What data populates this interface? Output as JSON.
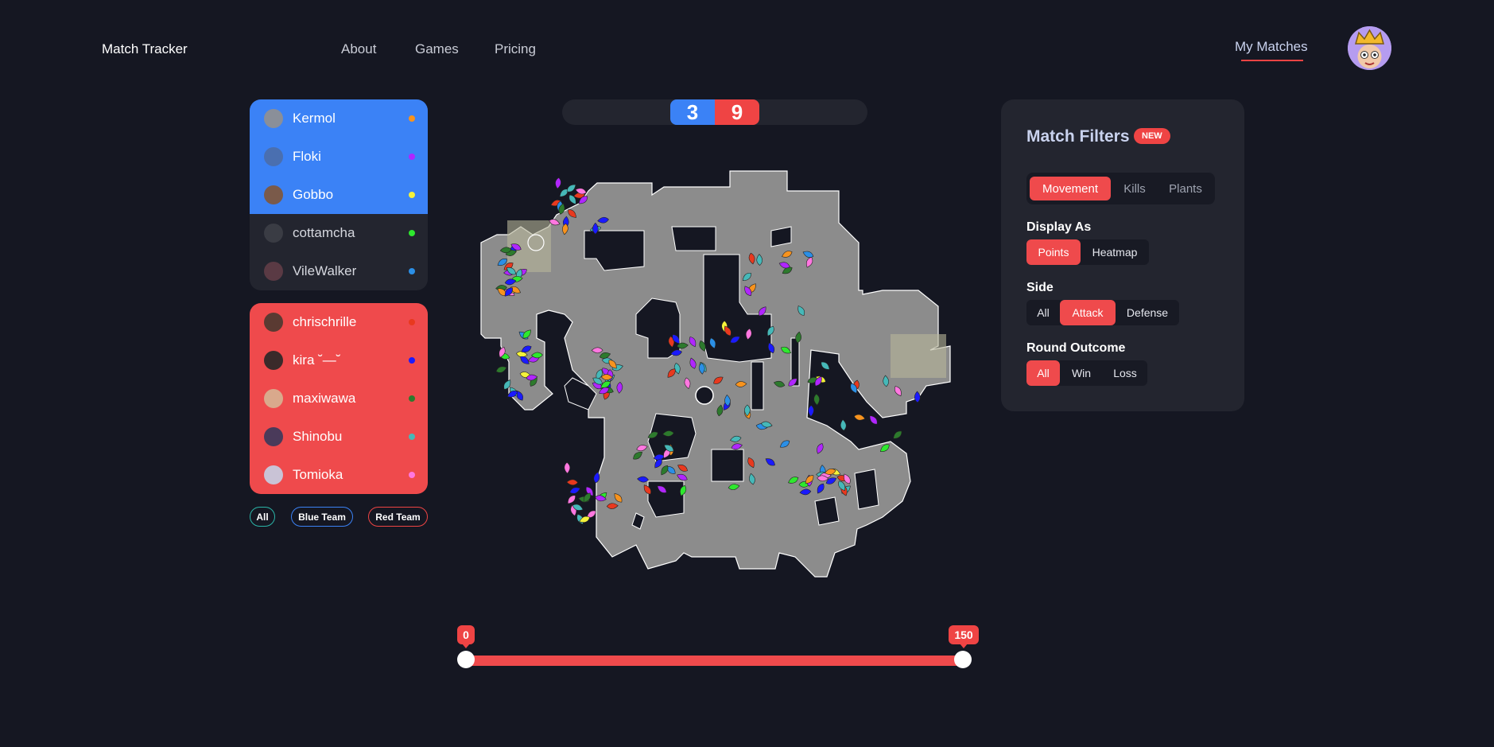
{
  "header": {
    "brand": "Match Tracker",
    "nav": [
      "About",
      "Games",
      "Pricing"
    ],
    "my_matches": "My Matches"
  },
  "roster": {
    "blue_team": [
      {
        "name": "Kermol",
        "dot_color": "#f7931e",
        "avatar_color": "#8a8f99",
        "selected": true
      },
      {
        "name": "Floki",
        "dot_color": "#b026ff",
        "avatar_color": "#4a6fb0",
        "selected": true
      },
      {
        "name": "Gobbo",
        "dot_color": "#f4f23a",
        "avatar_color": "#7a5a4a",
        "selected": true
      },
      {
        "name": "cottamcha",
        "dot_color": "#2ee82e",
        "avatar_color": "#3a3c44",
        "selected": false
      },
      {
        "name": "VileWalker",
        "dot_color": "#2b8fe6",
        "avatar_color": "#5a3a44",
        "selected": false
      }
    ],
    "red_team": [
      {
        "name": "chrischrille",
        "dot_color": "#e8391e",
        "avatar_color": "#5a3a32"
      },
      {
        "name": "kira ˘—˘",
        "dot_color": "#1a1aff",
        "avatar_color": "#3a2a2a"
      },
      {
        "name": "maxiwawa",
        "dot_color": "#2d7a2d",
        "avatar_color": "#d9a98c"
      },
      {
        "name": "Shinobu",
        "dot_color": "#46b8b8",
        "avatar_color": "#4a3a5a"
      },
      {
        "name": "Tomioka",
        "dot_color": "#ff77e0",
        "avatar_color": "#c9c3d6"
      }
    ],
    "filters": [
      "All",
      "Blue Team",
      "Red Team"
    ]
  },
  "score": {
    "blue": "3",
    "red": "9"
  },
  "slider": {
    "min_label": "0",
    "max_label": "150",
    "min_value": 0,
    "max_value": 150,
    "low": 0,
    "high": 150
  },
  "filters_panel": {
    "title": "Match Filters",
    "badge": "NEW",
    "tabs": [
      "Movement",
      "Kills",
      "Plants"
    ],
    "active_tab": "Movement",
    "display_as": {
      "label": "Display As",
      "options": [
        "Points",
        "Heatmap"
      ],
      "active": "Points"
    },
    "side": {
      "label": "Side",
      "options": [
        "All",
        "Attack",
        "Defense"
      ],
      "active": "Attack"
    },
    "round_outcome": {
      "label": "Round Outcome",
      "options": [
        "All",
        "Win",
        "Loss"
      ],
      "active": "All"
    }
  },
  "colors": {
    "background": "#151722",
    "panel": "#23252f",
    "blue": "#3b82f6",
    "red": "#ef4444",
    "map_floor": "#8e8e8e"
  }
}
